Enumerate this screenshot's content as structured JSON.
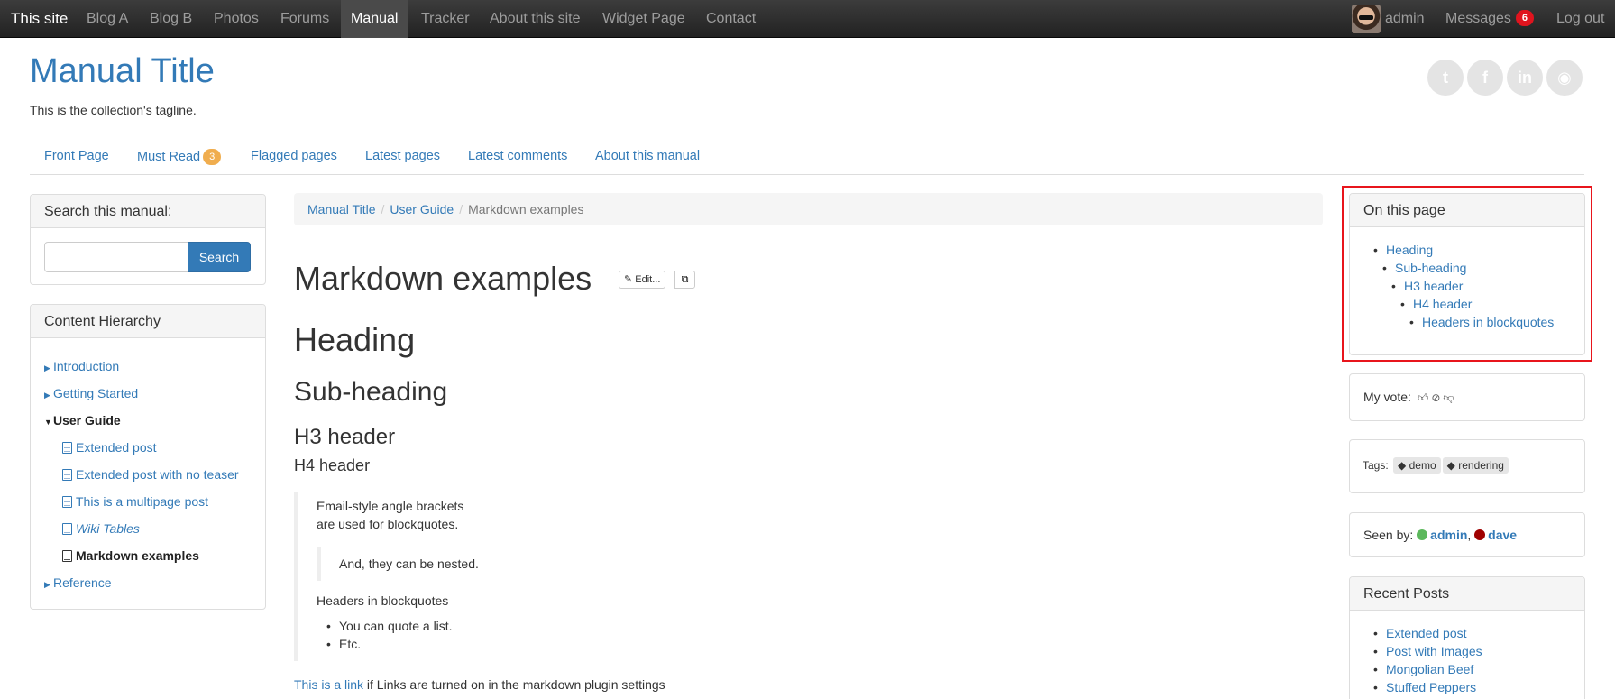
{
  "topnav": {
    "brand": "This site",
    "items": [
      "Blog A",
      "Blog B",
      "Photos",
      "Forums",
      "Manual",
      "Tracker",
      "About this site",
      "Widget Page",
      "Contact"
    ],
    "user": "admin",
    "messages": "Messages",
    "messages_count": "6",
    "logout": "Log out"
  },
  "header": {
    "title": "Manual Title",
    "tagline": "This is the collection's tagline.",
    "social": [
      "twitter-icon",
      "facebook-icon",
      "linkedin-icon",
      "github-icon"
    ]
  },
  "subnav": {
    "items": [
      "Front Page",
      "Must Read",
      "Flagged pages",
      "Latest pages",
      "Latest comments",
      "About this manual"
    ],
    "must_read_count": "3"
  },
  "search": {
    "heading": "Search this manual:",
    "button": "Search",
    "value": ""
  },
  "hierarchy": {
    "heading": "Content Hierarchy",
    "items": [
      "Introduction",
      "Getting Started",
      "User Guide",
      "Extended post",
      "Extended post with no teaser",
      "This is a multipage post",
      "Wiki Tables",
      "Markdown examples",
      "Reference"
    ]
  },
  "breadcrumb": [
    "Manual Title",
    "User Guide",
    "Markdown examples"
  ],
  "page": {
    "title": "Markdown examples",
    "edit": "Edit...",
    "heading": "Heading",
    "subheading": "Sub-heading",
    "h3": "H3 header",
    "h4": "H4 header",
    "bq_line1": "Email-style angle brackets",
    "bq_line2": "are used for blockquotes.",
    "bq_nested": "And, they can be nested.",
    "bq_heading": "Headers in blockquotes",
    "bq_list": [
      "You can quote a list.",
      "Etc."
    ],
    "link": "This is a link",
    "link_after": "if Links are turned on in the markdown plugin settings"
  },
  "toc": {
    "heading": "On this page",
    "items": [
      "Heading",
      "Sub-heading",
      "H3 header",
      "H4 header",
      "Headers in blockquotes"
    ]
  },
  "vote": {
    "label": "My vote:"
  },
  "tags": {
    "label": "Tags:",
    "items": [
      "demo",
      "rendering"
    ]
  },
  "seen": {
    "label": "Seen by:",
    "users": [
      "admin",
      "dave"
    ],
    "colors": [
      "#5cb85c",
      "#a00000"
    ],
    "comma": ","
  },
  "recent": {
    "heading": "Recent Posts",
    "items": [
      "Extended post",
      "Post with Images",
      "Mongolian Beef",
      "Stuffed Peppers"
    ]
  },
  "colors": {
    "accent": "#337ab7",
    "highlight": "#e8151c"
  }
}
